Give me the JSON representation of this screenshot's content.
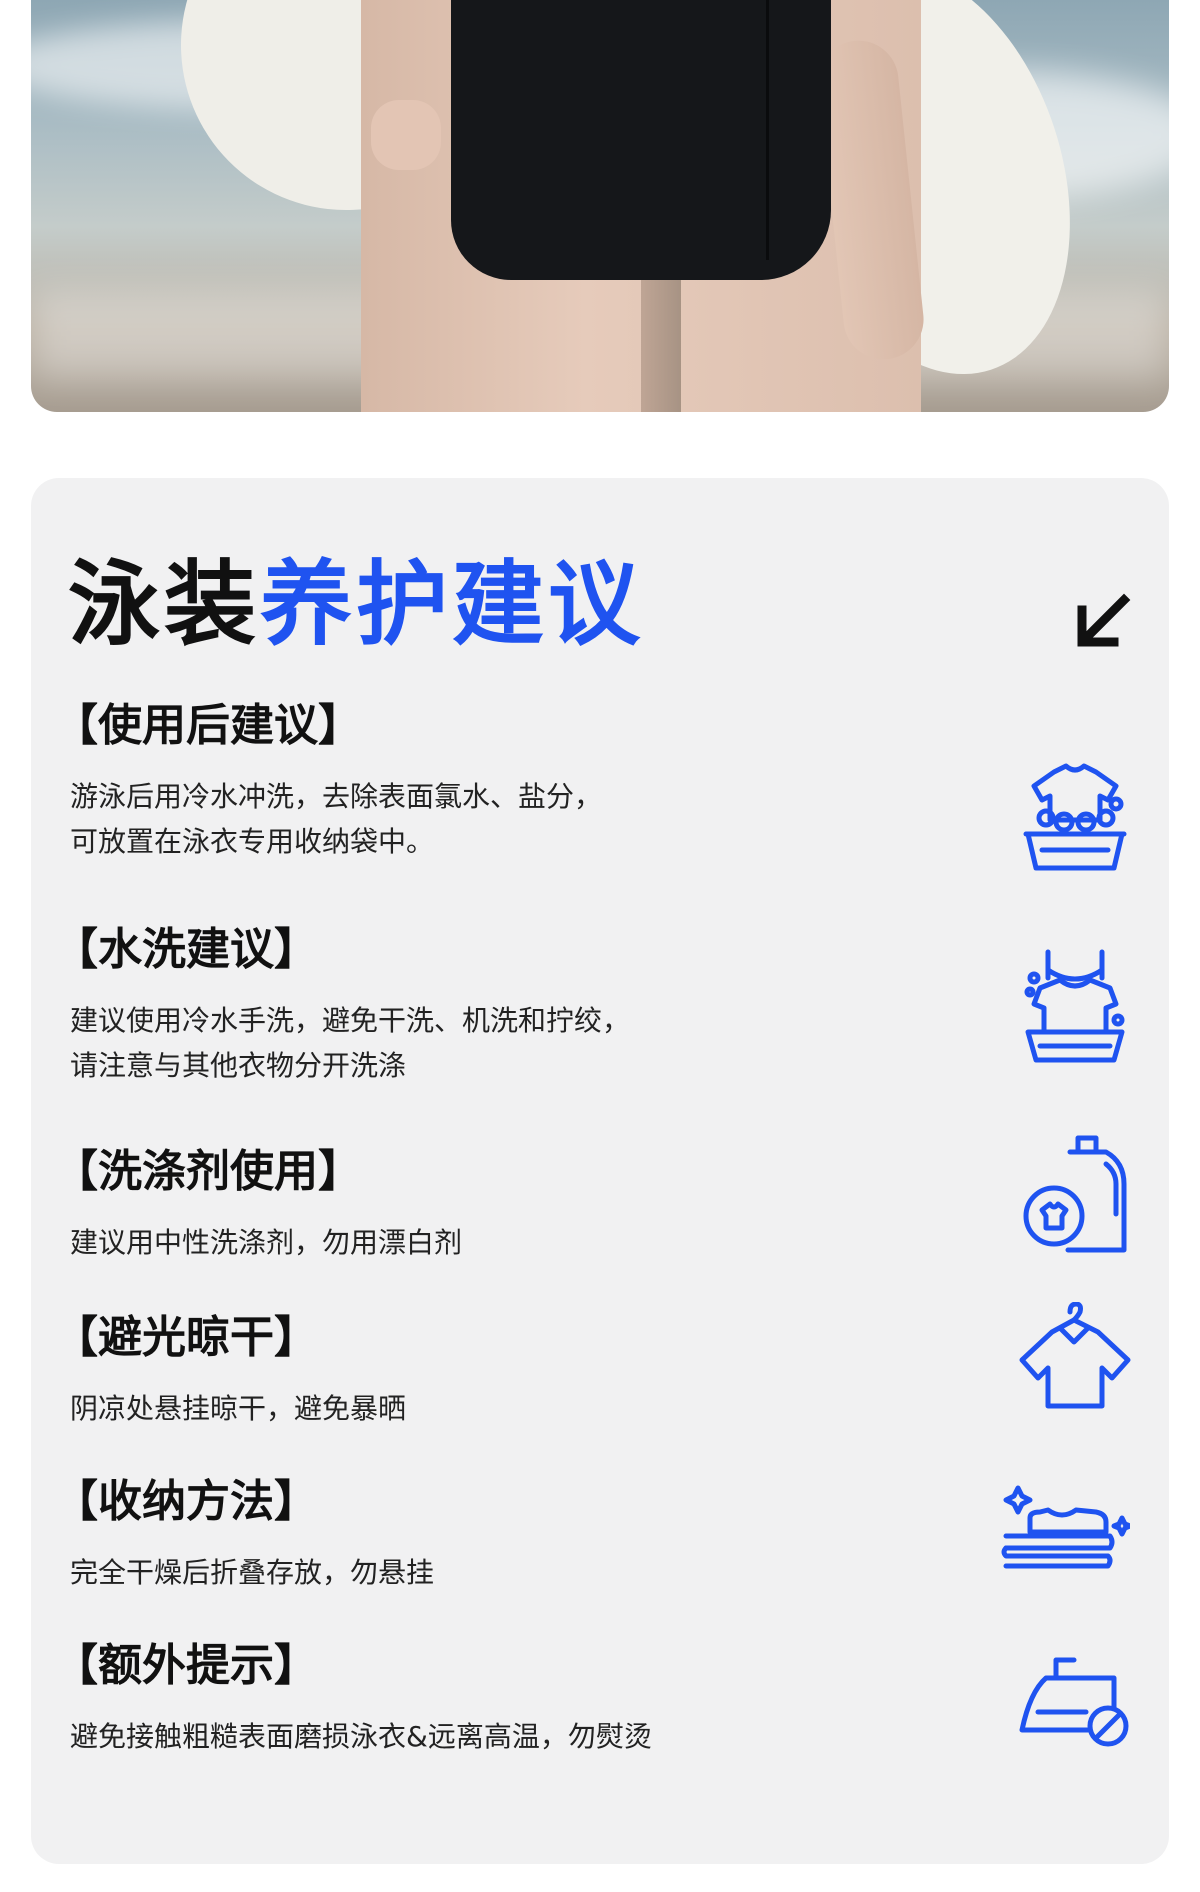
{
  "title": {
    "part1": "泳装",
    "part2": "养护建议"
  },
  "colors": {
    "accent": "#1f53f0",
    "card_bg": "#f1f1f2",
    "text": "#111111"
  },
  "sections": [
    {
      "heading": "【使用后建议】",
      "lines": [
        "游泳后用冷水冲洗，去除表面氯水、盐分，",
        "可放置在泳衣专用收纳袋中。"
      ],
      "icon": "wash-basin-shirt-icon"
    },
    {
      "heading": "【水洗建议】",
      "lines": [
        "建议使用冷水手洗，避免干洗、机洗和拧绞，",
        "请注意与其他衣物分开洗涤"
      ],
      "icon": "hand-wash-icon"
    },
    {
      "heading": "【洗涤剂使用】",
      "lines": [
        "建议用中性洗涤剂，勿用漂白剂"
      ],
      "icon": "detergent-bottle-icon"
    },
    {
      "heading": "【避光晾干】",
      "lines": [
        "阴凉处悬挂晾干，避免暴晒"
      ],
      "icon": "hanging-shirt-icon"
    },
    {
      "heading": "【收纳方法】",
      "lines": [
        "完全干燥后折叠存放，勿悬挂"
      ],
      "icon": "folded-clothes-icon"
    },
    {
      "heading": "【额外提示】",
      "lines": [
        "避免接触粗糙表面磨损泳衣&远离高温，勿熨烫"
      ],
      "icon": "no-iron-icon"
    }
  ]
}
